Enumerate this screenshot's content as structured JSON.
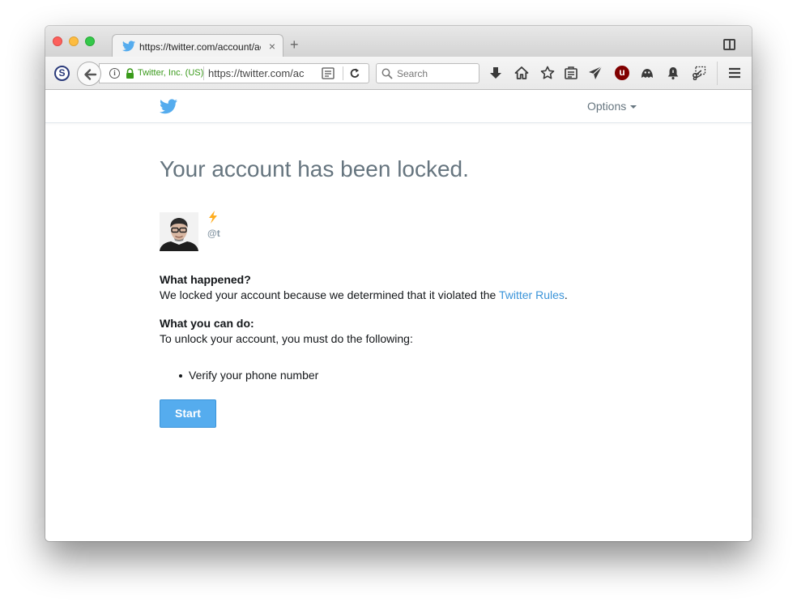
{
  "browser": {
    "tab": {
      "title": "https://twitter.com/account/ac",
      "close": "×"
    },
    "new_tab": "+",
    "identity": "Twitter, Inc. (US)",
    "url": "https://twitter.com/ac",
    "search_placeholder": "Search",
    "ext_s": "S",
    "ext_u": "u"
  },
  "page": {
    "header": {
      "options_label": "Options"
    },
    "headline": "Your account has been locked.",
    "user": {
      "handle": "@t"
    },
    "what_happened": {
      "title": "What happened?",
      "text_before": "We locked your account because we determined that it violated the ",
      "link": "Twitter Rules",
      "text_after": "."
    },
    "what_you_can_do": {
      "title": "What you can do:",
      "text": "To unlock your account, you must do the following:",
      "steps": [
        "Verify your phone number"
      ]
    },
    "start_button": "Start"
  },
  "colors": {
    "twitter_blue": "#55acee",
    "link": "#3b94d9",
    "muted": "#66757f",
    "identity_green": "#3a9a1b"
  }
}
